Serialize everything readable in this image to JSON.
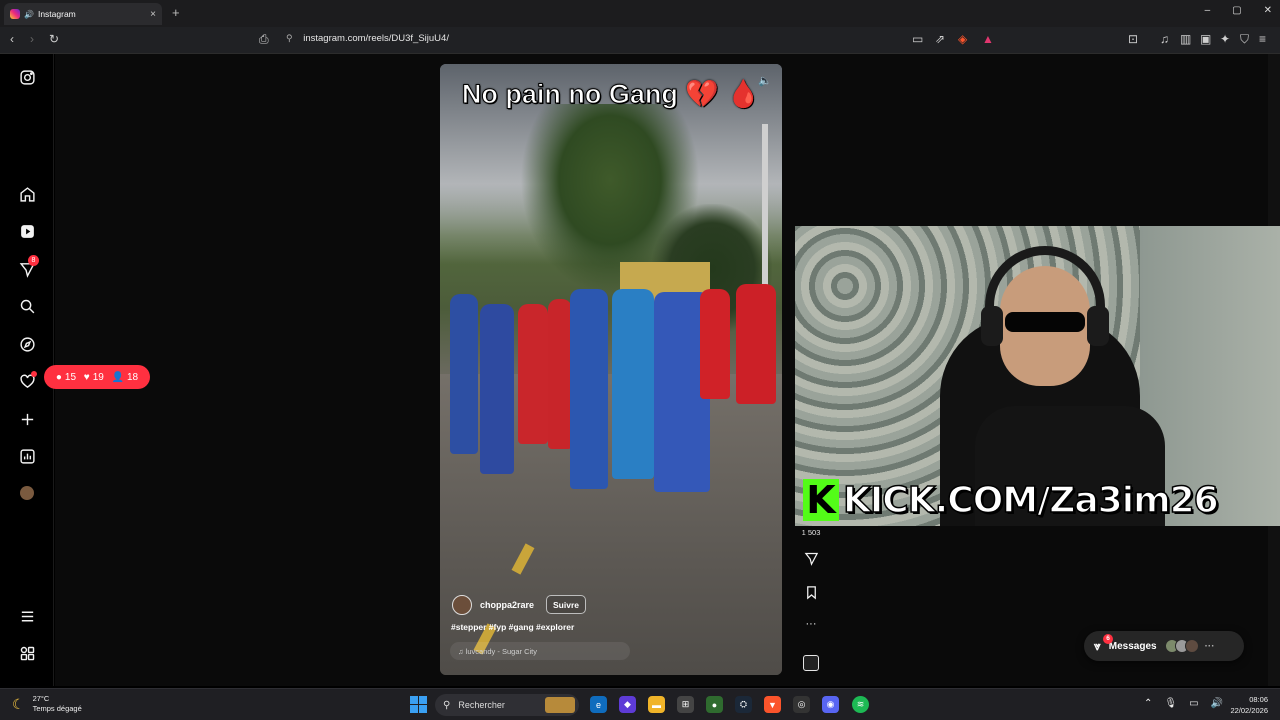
{
  "browser": {
    "tab_title": "Instagram",
    "tab_close": "×",
    "new_tab": "+",
    "url": "instagram.com/reels/DU3f_SijuU4/",
    "window_controls": [
      "–",
      "▢",
      "✕"
    ]
  },
  "sidebar": {
    "messages_badge": "8",
    "notifications": {
      "comments": "15",
      "likes": "19",
      "follows": "18"
    }
  },
  "reel": {
    "overlay_text": "No pain no Gang",
    "overlay_emojis": "💔 🩸",
    "username": "choppa2rare",
    "follow_label": "Suivre",
    "hashtags": "#stepper #fyp #gang #explorer",
    "music": "♫ luvcandy - Sugar City"
  },
  "actions": {
    "comment_count": "1 503"
  },
  "stream_overlay": {
    "kick_letter": "K",
    "kick_text": "KICK.COM/Za3im26"
  },
  "messages": {
    "label": "Messages",
    "badge": "6",
    "more": "···"
  },
  "taskbar": {
    "temperature": "27°C",
    "weather_desc": "Temps dégagé",
    "search_placeholder": "Rechercher",
    "time": "08:06",
    "date": "22/02/2026"
  },
  "colors": {
    "instagram_red": "#ff3040",
    "kick_green": "#53fc18",
    "background": "#0a0a0a"
  }
}
